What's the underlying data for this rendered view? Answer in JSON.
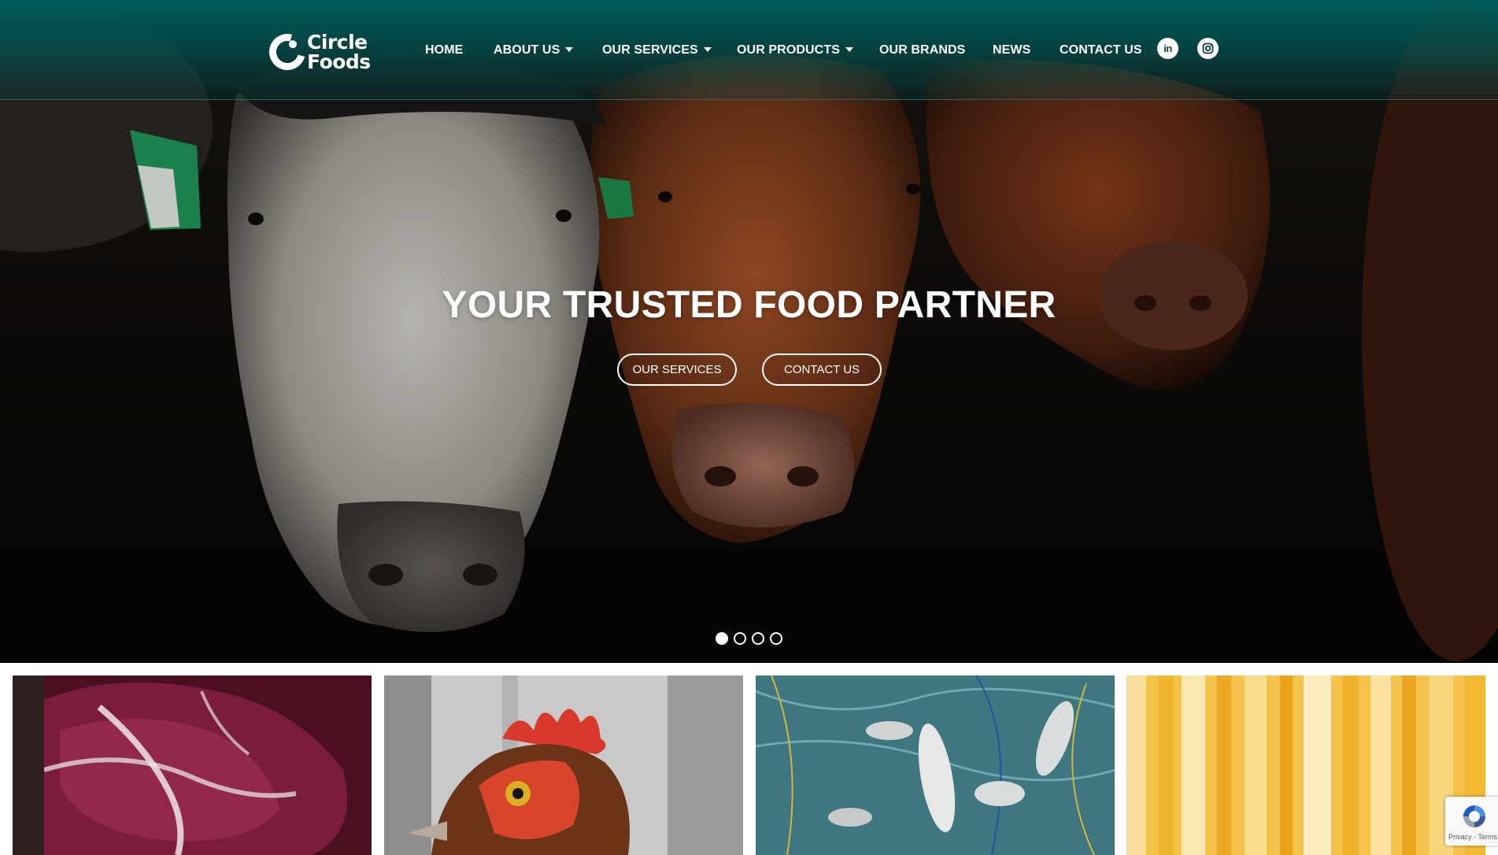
{
  "brand": {
    "name_line1": "Circle",
    "name_line2": "Foods"
  },
  "nav": {
    "items": [
      {
        "label": "HOME",
        "dropdown": false
      },
      {
        "label": "ABOUT US",
        "dropdown": true
      },
      {
        "label": "OUR SERVICES",
        "dropdown": true
      },
      {
        "label": "OUR PRODUCTS",
        "dropdown": true
      },
      {
        "label": "OUR BRANDS",
        "dropdown": false
      },
      {
        "label": "NEWS",
        "dropdown": false
      },
      {
        "label": "CONTACT US",
        "dropdown": false
      }
    ],
    "social": [
      {
        "icon": "linkedin-icon",
        "glyph": "in"
      },
      {
        "icon": "instagram-icon",
        "glyph": ""
      }
    ]
  },
  "hero": {
    "title": "YOUR TRUSTED FOOD PARTNER",
    "buttons": [
      {
        "label": "OUR SERVICES"
      },
      {
        "label": "CONTACT US"
      }
    ],
    "slides_total": 4,
    "active_slide": 1
  },
  "cards": [
    {
      "icon": "beef-steak-image"
    },
    {
      "icon": "chicken-image"
    },
    {
      "icon": "fish-net-image"
    },
    {
      "icon": "pasta-image"
    }
  ],
  "recaptcha": {
    "text": "Privacy - Terms"
  },
  "colors": {
    "header_teal": "#005c5a",
    "white": "#ffffff"
  }
}
